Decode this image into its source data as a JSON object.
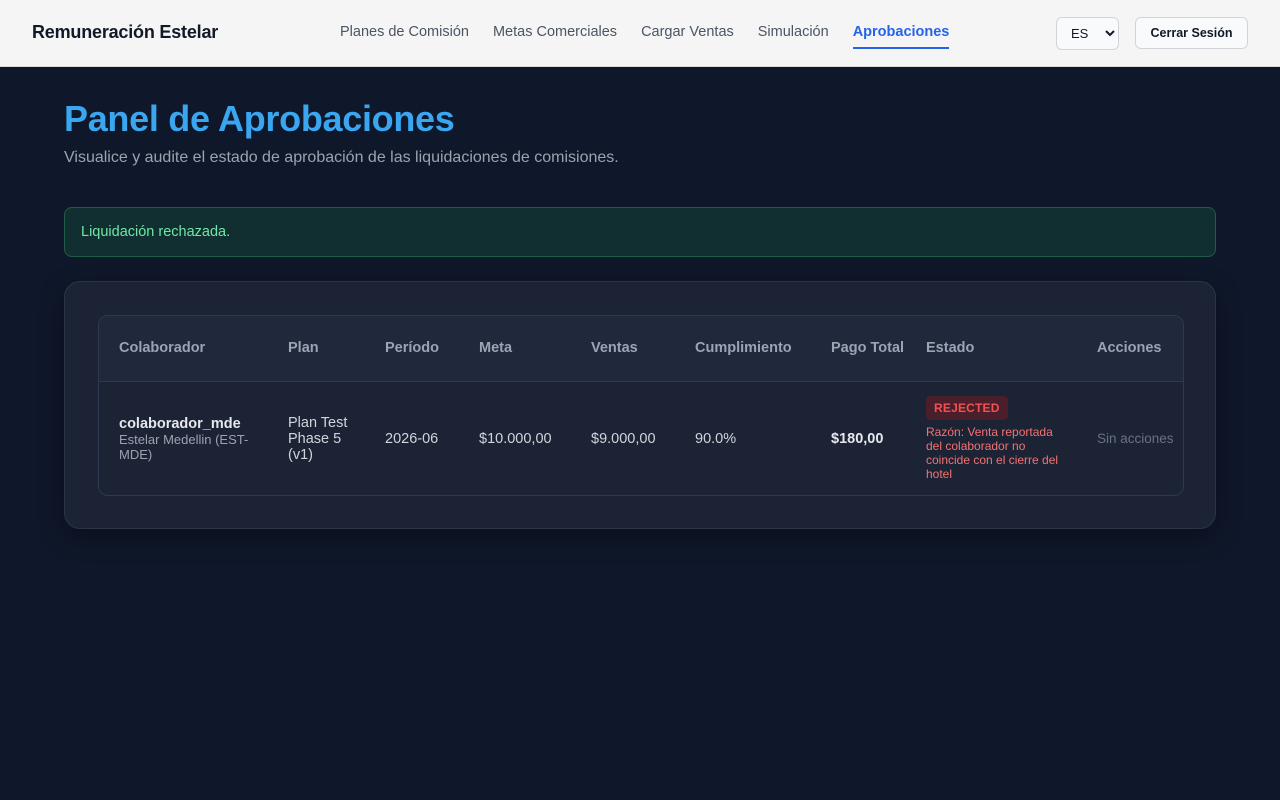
{
  "app": {
    "brand": "Remuneración Estelar"
  },
  "nav": {
    "items": [
      {
        "label": "Planes de Comisión",
        "active": false
      },
      {
        "label": "Metas Comerciales",
        "active": false
      },
      {
        "label": "Cargar Ventas",
        "active": false
      },
      {
        "label": "Simulación",
        "active": false
      },
      {
        "label": "Aprobaciones",
        "active": true
      }
    ],
    "language": {
      "selected": "ES",
      "options": [
        "ES"
      ]
    },
    "logout_label": "Cerrar Sesión"
  },
  "header": {
    "title": "Panel de Aprobaciones",
    "subtitle": "Visualice y audite el estado de aprobación de las liquidaciones de comisiones."
  },
  "alert": {
    "message": "Liquidación rechazada.",
    "type": "success"
  },
  "table": {
    "columns": [
      "Colaborador",
      "Plan",
      "Período",
      "Meta",
      "Ventas",
      "Cumplimiento",
      "Pago Total",
      "Estado",
      "Acciones"
    ],
    "rows": [
      {
        "collaborator": "colaborador_mde",
        "branch": "Estelar Medellin (EST-MDE)",
        "plan": "Plan Test Phase 5 (v1)",
        "period": "2026-06",
        "meta": "$10.000,00",
        "sales": "$9.000,00",
        "fulfillment": "90.0%",
        "total_payment": "$180,00",
        "status": "REJECTED",
        "reason": "Razón: Venta reportada del colaborador no coincide con el cierre del hotel",
        "actions": "Sin acciones"
      }
    ]
  },
  "colors": {
    "background": "#0f172a",
    "accent": "#2563eb",
    "title": "#3aa6f0",
    "success": "#6ee7a6",
    "danger": "#f05252"
  }
}
